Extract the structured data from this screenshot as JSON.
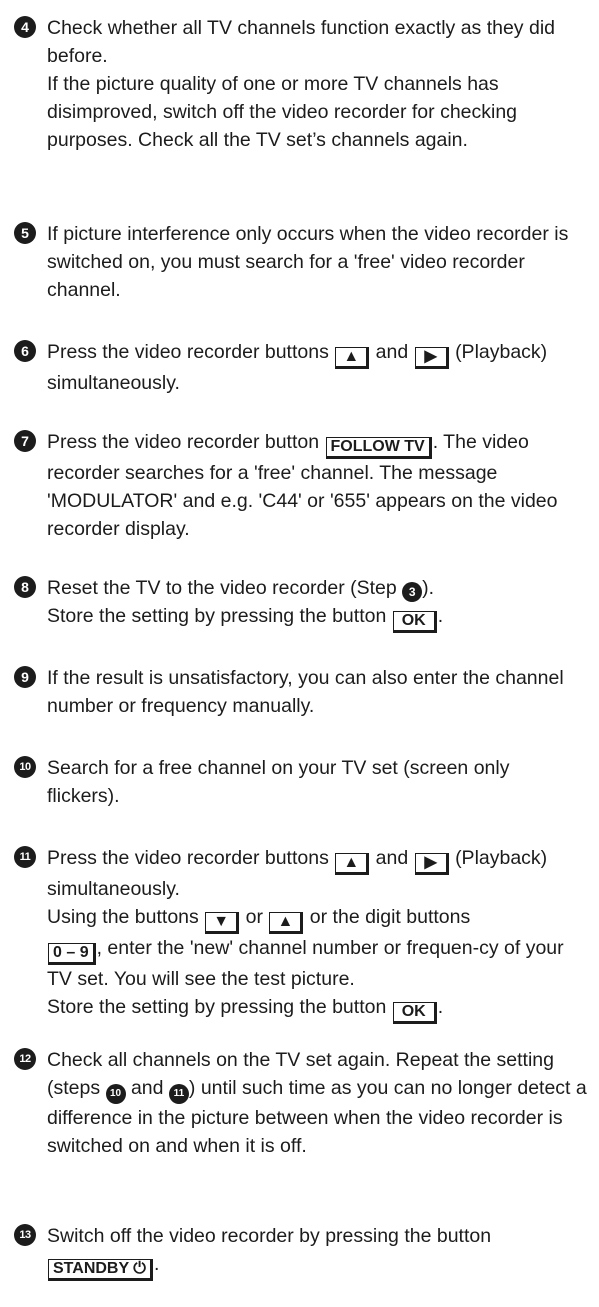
{
  "steps": [
    {
      "num": "4",
      "lines": [
        "Check whether all TV channels function exactly as they did before.",
        "If the picture quality of one or more TV channels has disimproved, switch off the video recorder for checking purposes. Check all the TV set’s channels again."
      ]
    },
    {
      "num": "5",
      "text": "If picture interference only occurs when the video recorder is switched on, you must search for a 'free' video recorder channel."
    },
    {
      "num": "6",
      "a": "Press the video recorder buttons",
      "b": "and",
      "c": "(Playback) simultaneously."
    },
    {
      "num": "7",
      "a": "Press the video recorder button",
      "key": "FOLLOW TV",
      "b": ". The video recorder searches for a 'free' channel. The message 'MODULATOR' and e.g. 'C44' or '655' appears on the video recorder display."
    },
    {
      "num": "8",
      "a": "Reset the TV to the video recorder (Step",
      "ref": "3",
      "b": ").",
      "c": "Store the setting by pressing the button",
      "key": "OK",
      "d": "."
    },
    {
      "num": "9",
      "text": "If the result is unsatisfactory, you can also enter the channel number or frequency manually."
    },
    {
      "num": "10",
      "text": "Search for a free channel on your TV set (screen only flickers)."
    },
    {
      "num": "11",
      "a": "Press the video recorder buttons",
      "b": "and",
      "c": "(Playback) simultaneously.",
      "d": "Using the buttons",
      "e": "or",
      "f": "or the digit buttons",
      "key_digits": "0 – 9",
      "g": ", enter the 'new' channel number or frequen-cy of your TV set. You will see the test picture.",
      "h": "Store the setting by pressing the button",
      "key_ok": "OK",
      "i": "."
    },
    {
      "num": "12",
      "a": "Check all channels on the TV set again. Repeat the setting (steps",
      "ref1": "10",
      "b": "and",
      "ref2": "11",
      "c": ") until such time as you can no longer detect a difference in the picture between when the video recorder is switched on and when it is off."
    },
    {
      "num": "13",
      "a": "Switch off the video recorder by pressing the button",
      "key": "STANDBY ⏻",
      "b": "."
    }
  ],
  "icons": {
    "eject": "eject-icon",
    "play": "play-icon",
    "down": "down-arrow-icon",
    "up": "up-arrow-icon"
  }
}
